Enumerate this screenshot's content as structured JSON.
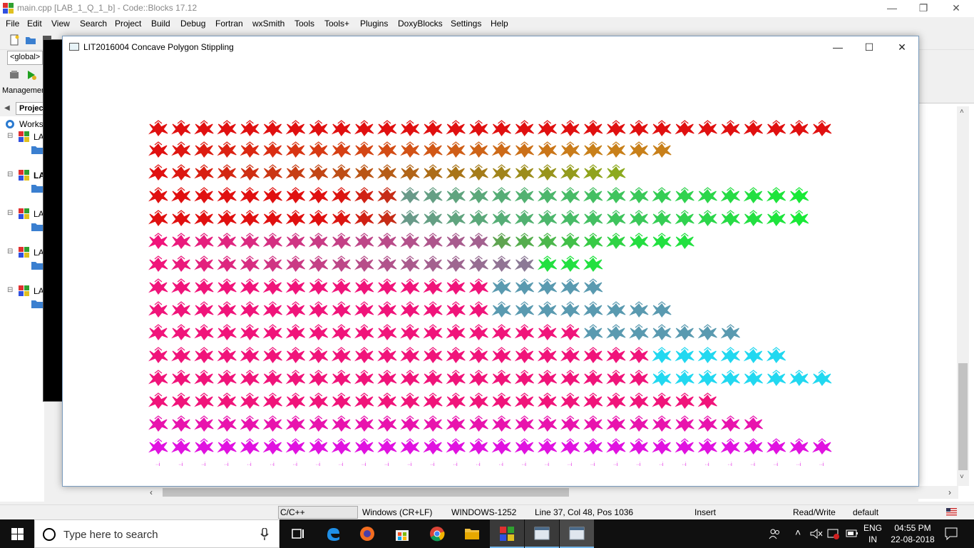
{
  "codeblocks": {
    "title": "main.cpp [LAB_1_Q_1_b] - Code::Blocks 17.12",
    "menu": [
      "File",
      "Edit",
      "View",
      "Search",
      "Project",
      "Build",
      "Debug",
      "Fortran",
      "wxSmith",
      "Tools",
      "Tools+",
      "Plugins",
      "DoxyBlocks",
      "Settings",
      "Help"
    ],
    "scope_dropdown": "<global>",
    "management_label": "Managemer",
    "projects_tab": "Projec",
    "tree": [
      {
        "label": "Works",
        "bold": false
      },
      {
        "label": "LA",
        "bold": false
      },
      {
        "label": "LA",
        "bold": true
      },
      {
        "label": "LA",
        "bold": false
      },
      {
        "label": "LA",
        "bold": false
      },
      {
        "label": "LA",
        "bold": false
      }
    ],
    "window_controls": {
      "minimize": "—",
      "maximize": "❐",
      "close": "✕"
    }
  },
  "statusbar": {
    "language": "C/C++",
    "line_endings": "Windows (CR+LF)",
    "encoding": "WINDOWS-1252",
    "position": "Line 37, Col 48, Pos 1036",
    "mode": "Insert",
    "access": "Read/Write",
    "profile": "default"
  },
  "gl_window": {
    "title": "LIT2016004 Concave Polygon Stippling",
    "controls": {
      "minimize": "—",
      "maximize": "☐",
      "close": "✕"
    },
    "colors": {
      "top": "#e01010",
      "orange": "#c8801a",
      "olive": "#8caa1e",
      "green": "#22e040",
      "grey": "#7a8a9a",
      "teal": "#5a9ab0",
      "cyan": "#22d8f0",
      "pink": "#f0147a",
      "magenta": "#e012e0"
    }
  },
  "taskbar": {
    "search_placeholder": "Type here to search",
    "tray": {
      "lang_top": "ENG",
      "lang_bottom": "IN",
      "time": "04:55 PM",
      "date": "22-08-2018"
    }
  }
}
